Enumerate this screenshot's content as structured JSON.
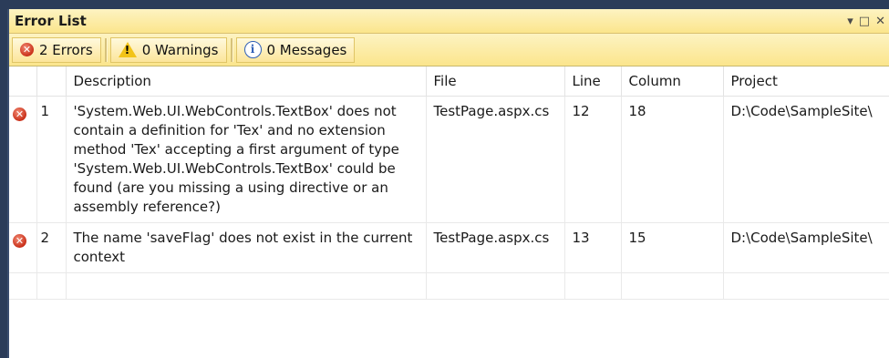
{
  "window": {
    "title": "Error List",
    "dropdown_glyph": "▾",
    "maximize_glyph": "□",
    "close_glyph": "✕"
  },
  "toolbar": {
    "errors_label": "2 Errors",
    "warnings_label": "0 Warnings",
    "messages_label": "0 Messages"
  },
  "columns": {
    "description": "Description",
    "file": "File",
    "line": "Line",
    "column": "Column",
    "project": "Project"
  },
  "rows": [
    {
      "num": "1",
      "description": "'System.Web.UI.WebControls.TextBox' does not contain a definition for 'Tex' and no extension method 'Tex' accepting a first argument of type 'System.Web.UI.WebControls.TextBox' could be found (are you missing a using directive or an assembly reference?)",
      "file": "TestPage.aspx.cs",
      "line": "12",
      "column": "18",
      "project": "D:\\Code\\SampleSite\\"
    },
    {
      "num": "2",
      "description": "The name 'saveFlag' does not exist in the current context",
      "file": "TestPage.aspx.cs",
      "line": "13",
      "column": "15",
      "project": "D:\\Code\\SampleSite\\"
    }
  ],
  "colors": {
    "toolbar_bg": "#fbe58c",
    "error_red": "#c9301a",
    "warning_yellow": "#f2c318",
    "info_blue": "#2f5fb6"
  }
}
